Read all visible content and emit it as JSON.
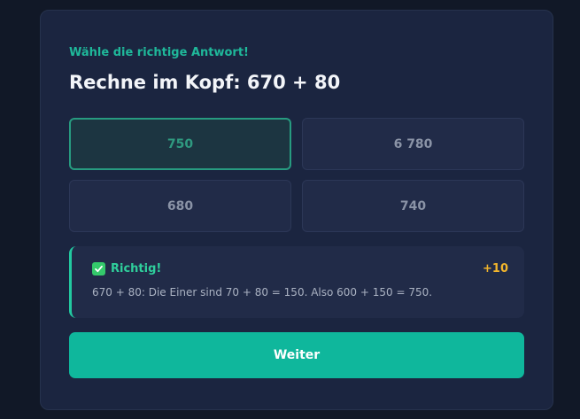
{
  "quiz": {
    "instruction": "Wähle die richtige Antwort!",
    "question": "Rechne im Kopf: 670 + 80",
    "answers": [
      {
        "label": "750",
        "state": "correct"
      },
      {
        "label": "6 780",
        "state": "default"
      },
      {
        "label": "680",
        "state": "default"
      },
      {
        "label": "740",
        "state": "default"
      }
    ]
  },
  "feedback": {
    "icon": "checkmark-icon",
    "title": "Richtig!",
    "points": "+10",
    "explanation": "670 + 80: Die Einer sind 70 + 80 = 150. Also 600 + 150 = 750."
  },
  "actions": {
    "next_label": "Weiter"
  },
  "colors": {
    "accent": "#0fb79c",
    "correct": "#279b80",
    "points": "#f2b52c",
    "card": "#1b2540",
    "background": "#111827"
  }
}
